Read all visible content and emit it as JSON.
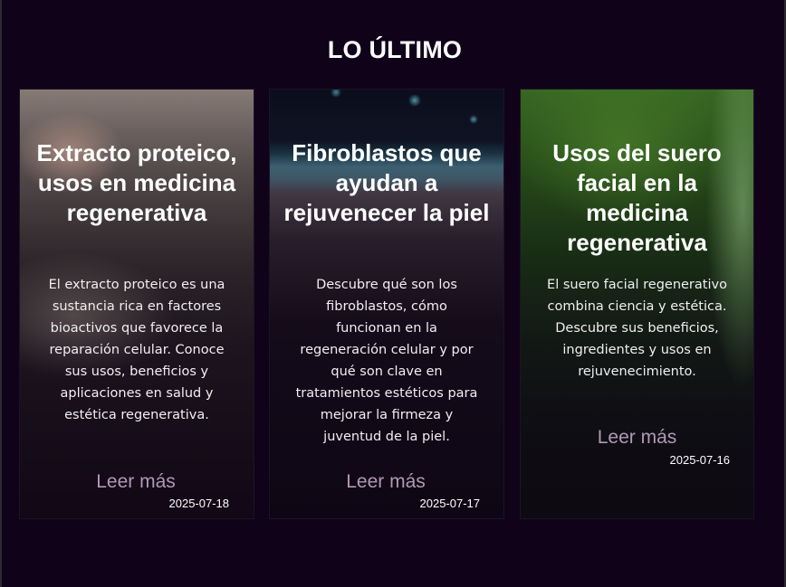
{
  "section": {
    "title": "LO ÚLTIMO"
  },
  "cards": [
    {
      "title": "Extracto proteico, usos en medicina regenerativa",
      "excerpt": "El extracto proteico es una sustancia rica en factores bioactivos que favorece la reparación celular. Conoce sus usos, beneficios y aplicaciones en salud y estética regenerativa.",
      "read_more": "Leer más",
      "date": "2025-07-18"
    },
    {
      "title": "Fibroblastos que ayudan a rejuvenecer la piel",
      "excerpt": "Descubre qué son los fibroblastos, cómo funcionan en la regeneración celular y por qué son clave en tratamientos estéticos para mejorar la firmeza y juventud de la piel.",
      "read_more": "Leer más",
      "date": "2025-07-17"
    },
    {
      "title": "Usos del suero facial en la medicina regenerativa",
      "excerpt": "El suero facial regenerativo combina ciencia y estética. Descubre sus beneficios, ingredientes y usos en rejuvenecimiento.",
      "read_more": "Leer más",
      "date": "2025-07-16"
    }
  ],
  "colors": {
    "page_background": "#100319",
    "read_more_link": "#b298b6",
    "title_text": "#ffffff"
  }
}
